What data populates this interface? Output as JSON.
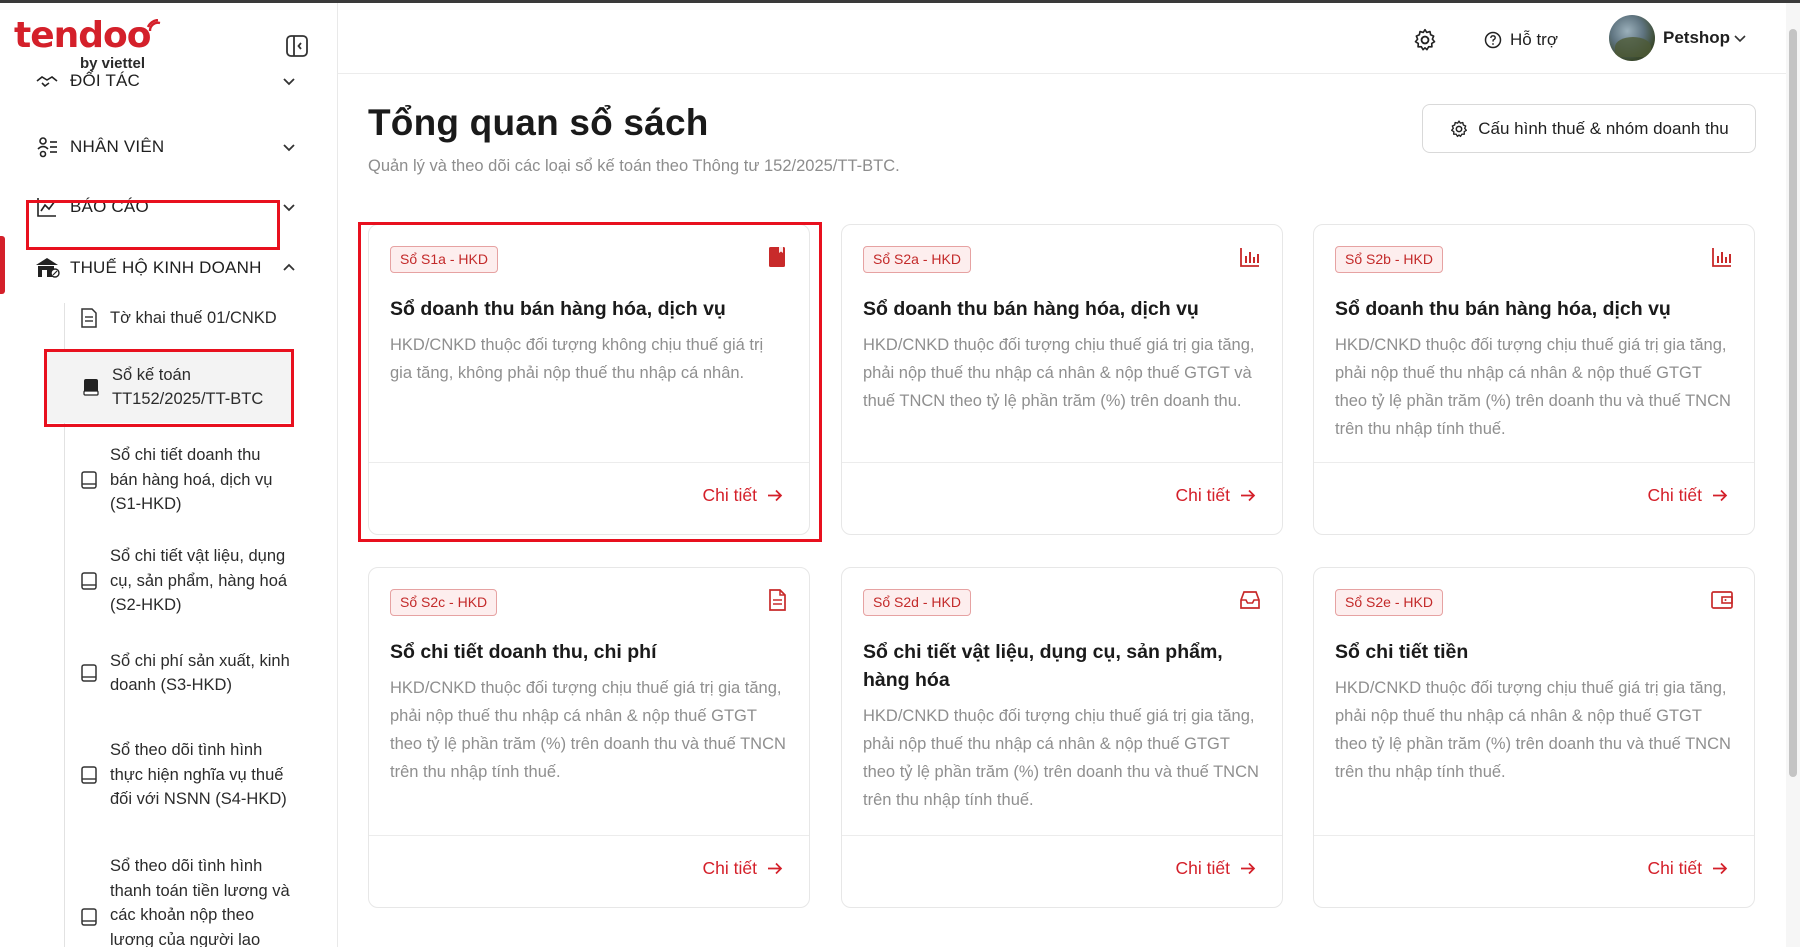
{
  "brand": {
    "name": "tendoo",
    "sub": "by viettel"
  },
  "sidebar": {
    "groups": [
      {
        "label": "ĐỐI TÁC"
      },
      {
        "label": "NHÂN VIÊN"
      },
      {
        "label": "BÁO CÁO"
      },
      {
        "label": "THUẾ HỘ KINH DOANH"
      }
    ],
    "sub_items": [
      {
        "label": "Tờ khai thuế 01/CNKD"
      },
      {
        "label": "Sổ kế toán TT152/2025/TT-BTC"
      },
      {
        "label": "Sổ chi tiết doanh thu bán hàng hoá, dịch vụ (S1-HKD)"
      },
      {
        "label": "Sổ chi tiết vật liệu, dụng cụ, sản phẩm, hàng hoá (S2-HKD)"
      },
      {
        "label": "Sổ chi phí sản xuất, kinh doanh (S3-HKD)"
      },
      {
        "label": "Sổ theo dõi tình hình thực hiện nghĩa vụ thuế đối với NSNN (S4-HKD)"
      },
      {
        "label": "Sổ theo dõi tình hình thanh toán tiền lương và các khoản nộp theo lương của người lao"
      }
    ]
  },
  "header": {
    "help_label": "Hỗ trợ",
    "user_name": "Petshop"
  },
  "main": {
    "title": "Tổng quan sổ sách",
    "subtitle": "Quản lý và theo dõi các loại sổ kế toán theo Thông tư 152/2025/TT-BTC.",
    "config_button": "Cấu hình thuế & nhóm doanh thu",
    "detail_label": "Chi tiết",
    "cards": [
      {
        "badge": "Sổ S1a - HKD",
        "title": "Sổ doanh thu bán hàng hóa, dịch vụ",
        "desc": "HKD/CNKD thuộc đối tượng không chịu thuế giá trị gia tăng, không phải nộp thuế thu nhập cá nhân.",
        "icon": "book-icon"
      },
      {
        "badge": "Sổ S2a - HKD",
        "title": "Sổ doanh thu bán hàng hóa, dịch vụ",
        "desc": "HKD/CNKD thuộc đối tượng chịu thuế giá trị gia tăng, phải nộp thuế thu nhập cá nhân & nộp thuế GTGT và thuế TNCN theo tỷ lệ phần trăm (%) trên doanh thu.",
        "icon": "bar-chart-icon"
      },
      {
        "badge": "Sổ S2b - HKD",
        "title": "Sổ doanh thu bán hàng hóa, dịch vụ",
        "desc": "HKD/CNKD thuộc đối tượng chịu thuế giá trị gia tăng, phải nộp thuế thu nhập cá nhân & nộp thuế GTGT theo tỷ lệ phần trăm (%) trên doanh thu và thuế TNCN trên thu nhập tính thuế.",
        "icon": "bar-chart-icon"
      },
      {
        "badge": "Sổ S2c - HKD",
        "title": "Sổ chi tiết doanh thu, chi phí",
        "desc": "HKD/CNKD thuộc đối tượng chịu thuế giá trị gia tăng, phải nộp thuế thu nhập cá nhân & nộp thuế GTGT theo tỷ lệ phần trăm (%) trên doanh thu và thuế TNCN trên thu nhập tính thuế.",
        "icon": "document-icon"
      },
      {
        "badge": "Sổ S2d - HKD",
        "title": "Sổ chi tiết vật liệu, dụng cụ, sản phẩm, hàng hóa",
        "desc": "HKD/CNKD thuộc đối tượng chịu thuế giá trị gia tăng, phải nộp thuế thu nhập cá nhân & nộp thuế GTGT theo tỷ lệ phần trăm (%) trên doanh thu và thuế TNCN trên thu nhập tính thuế.",
        "icon": "inbox-icon"
      },
      {
        "badge": "Sổ S2e - HKD",
        "title": "Sổ chi tiết tiền",
        "desc": "HKD/CNKD thuộc đối tượng chịu thuế giá trị gia tăng, phải nộp thuế thu nhập cá nhân & nộp thuế GTGT theo tỷ lệ phần trăm (%) trên doanh thu và thuế TNCN trên thu nhập tính thuế.",
        "icon": "wallet-icon"
      }
    ]
  },
  "colors": {
    "brand_red": "#d4202a",
    "highlight_red": "#e8101e"
  }
}
